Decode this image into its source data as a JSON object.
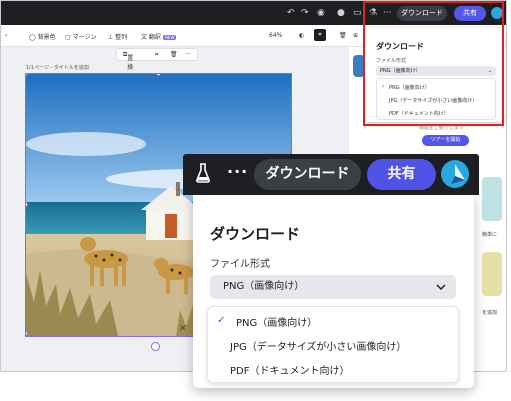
{
  "topbar": {
    "download_label": "ダウンロード",
    "share_label": "共有"
  },
  "toolbar": {
    "items": [
      "背景色",
      "マージン",
      "整列",
      "翻訳"
    ],
    "new_badge": "NEW",
    "zoom": "64%"
  },
  "float_tools": {
    "replace_label": "置換"
  },
  "canvas": {
    "page_title": "1/1ページ - タイトルを追加"
  },
  "mini_dropdown": {
    "title": "ダウンロード",
    "format_label": "ファイル形式",
    "selected": "PNG（画像向け）",
    "options": [
      "PNG（画像向け）",
      "JPG（データサイズが小さい画像向け）",
      "PDF（ドキュメント向け）"
    ]
  },
  "right_panel": {
    "tour_button": "ツアーを開始",
    "snippet_1": "機能をご紹介します",
    "snippet_2": "簡単に",
    "snippet_3": "を追加"
  },
  "zoom": {
    "download_label": "ダウンロード",
    "share_label": "共有",
    "title": "ダウンロード",
    "format_label": "ファイル形式",
    "selected": "PNG（画像向け）",
    "options": [
      "PNG（画像向け）",
      "JPG（データサイズが小さい画像向け）",
      "PDF（ドキュメント向け）"
    ]
  },
  "colors": {
    "accent": "#4f54e6",
    "highlight": "#e22121",
    "dark": "#1d1f24"
  }
}
